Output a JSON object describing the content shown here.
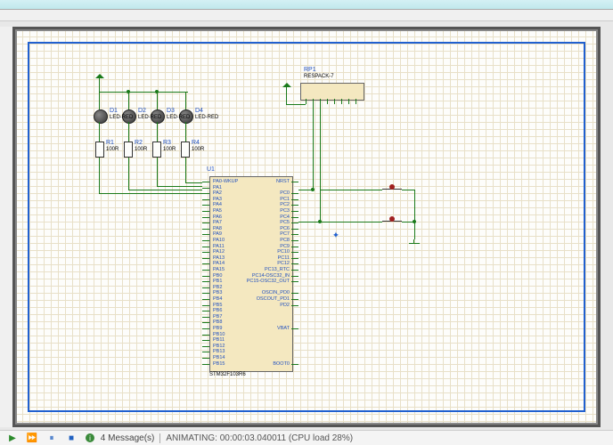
{
  "window": {
    "title": ""
  },
  "components": {
    "leds": [
      {
        "ref": "D1",
        "value": "LED-RED"
      },
      {
        "ref": "D2",
        "value": "LED-RED"
      },
      {
        "ref": "D3",
        "value": "LED-RED"
      },
      {
        "ref": "D4",
        "value": "LED-RED"
      }
    ],
    "resistors": [
      {
        "ref": "R1",
        "value": "100R"
      },
      {
        "ref": "R2",
        "value": "100R"
      },
      {
        "ref": "R3",
        "value": "100R"
      },
      {
        "ref": "R4",
        "value": "100R"
      }
    ],
    "ic": {
      "ref": "U1",
      "value": "STM32F103R6",
      "left_pins": [
        "PA0-WKUP",
        "PA1",
        "PA2",
        "PA3",
        "PA4",
        "PA5",
        "PA6",
        "PA7",
        "PA8",
        "PA9",
        "PA10",
        "PA11",
        "PA12",
        "PA13",
        "PA14",
        "PA15",
        "PB0",
        "PB1",
        "PB2",
        "PB3",
        "PB4",
        "PB5",
        "PB6",
        "PB7",
        "PB8",
        "PB9",
        "PB10",
        "PB11",
        "PB12",
        "PB13",
        "PB14",
        "PB15"
      ],
      "right_pins": [
        "NRST",
        "",
        "PC0",
        "PC1",
        "PC2",
        "PC3",
        "PC4",
        "PC5",
        "PC6",
        "PC7",
        "PC8",
        "PC9",
        "PC10",
        "PC11",
        "PC12",
        "PC13_RTC",
        "PC14-OSC32_IN",
        "PC15-OSC32_OUT",
        "",
        "OSCIN_PD0",
        "OSCOUT_PD1",
        "PD2",
        "",
        "",
        "",
        "VBAT",
        "",
        "",
        "",
        "",
        "",
        "BOOT0"
      ]
    },
    "respack": {
      "ref": "RP1",
      "value": "RESPACK-7"
    },
    "buttons": 2
  },
  "status": {
    "messages": "4 Message(s)",
    "animating": "ANIMATING: 00:00:03.040011 (CPU load 28%)"
  },
  "sim_controls": {
    "play": "▶",
    "step": "⏩",
    "pause": "⏸",
    "stop": "■"
  }
}
